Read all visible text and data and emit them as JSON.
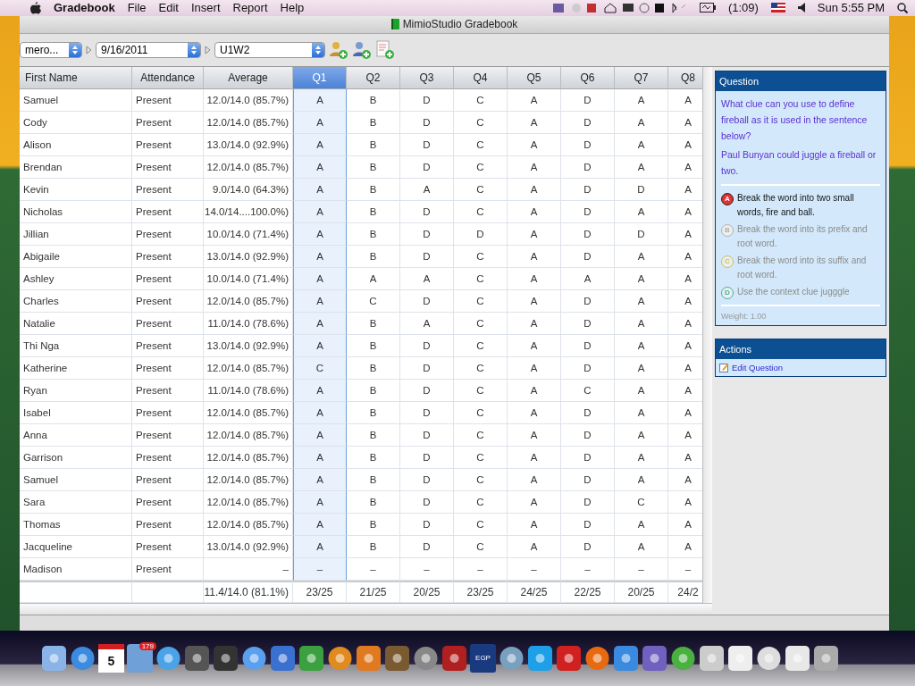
{
  "menu_bar": {
    "app_name": "Gradebook",
    "menus": [
      "File",
      "Edit",
      "Insert",
      "Report",
      "Help"
    ],
    "battery": "(1:09)",
    "clock": "Sun 5:55 PM"
  },
  "window": {
    "title": "MimioStudio Gradebook"
  },
  "toolbar": {
    "class_popup": "mero...",
    "date_popup": "9/16/2011",
    "assessment_popup": "U1W2"
  },
  "table": {
    "columns": [
      {
        "label": "First Name",
        "selected": false
      },
      {
        "label": "Attendance",
        "selected": false
      },
      {
        "label": "Average",
        "selected": false
      },
      {
        "label": "Q1",
        "selected": true
      },
      {
        "label": "Q2",
        "selected": false
      },
      {
        "label": "Q3",
        "selected": false
      },
      {
        "label": "Q4",
        "selected": false
      },
      {
        "label": "Q5",
        "selected": false
      },
      {
        "label": "Q6",
        "selected": false
      },
      {
        "label": "Q7",
        "selected": false
      },
      {
        "label": "Q8",
        "selected": false
      }
    ],
    "rows": [
      {
        "cells": [
          "Samuel",
          "Present",
          "12.0/14.0 (85.7%)",
          "A",
          "B",
          "D",
          "C",
          "A",
          "D",
          "A",
          "A"
        ]
      },
      {
        "cells": [
          "Cody",
          "Present",
          "12.0/14.0 (85.7%)",
          "A",
          "B",
          "D",
          "C",
          "A",
          "D",
          "A",
          "A"
        ]
      },
      {
        "cells": [
          "Alison",
          "Present",
          "13.0/14.0 (92.9%)",
          "A",
          "B",
          "D",
          "C",
          "A",
          "D",
          "A",
          "A"
        ]
      },
      {
        "cells": [
          "Brendan",
          "Present",
          "12.0/14.0 (85.7%)",
          "A",
          "B",
          "D",
          "C",
          "A",
          "D",
          "A",
          "A"
        ]
      },
      {
        "cells": [
          "Kevin",
          "Present",
          "9.0/14.0 (64.3%)",
          "A",
          "B",
          "A",
          "C",
          "A",
          "D",
          "D",
          "A"
        ]
      },
      {
        "cells": [
          "Nicholas",
          "Present",
          "14.0/14....100.0%)",
          "A",
          "B",
          "D",
          "C",
          "A",
          "D",
          "A",
          "A"
        ]
      },
      {
        "cells": [
          "Jillian",
          "Present",
          "10.0/14.0 (71.4%)",
          "A",
          "B",
          "D",
          "D",
          "A",
          "D",
          "D",
          "A"
        ]
      },
      {
        "cells": [
          "Abigaile",
          "Present",
          "13.0/14.0 (92.9%)",
          "A",
          "B",
          "D",
          "C",
          "A",
          "D",
          "A",
          "A"
        ]
      },
      {
        "cells": [
          "Ashley",
          "Present",
          "10.0/14.0 (71.4%)",
          "A",
          "A",
          "A",
          "C",
          "A",
          "A",
          "A",
          "A"
        ]
      },
      {
        "cells": [
          "Charles",
          "Present",
          "12.0/14.0 (85.7%)",
          "A",
          "C",
          "D",
          "C",
          "A",
          "D",
          "A",
          "A"
        ]
      },
      {
        "cells": [
          "Natalie",
          "Present",
          "11.0/14.0 (78.6%)",
          "A",
          "B",
          "A",
          "C",
          "A",
          "D",
          "A",
          "A"
        ]
      },
      {
        "cells": [
          "Thi Nga",
          "Present",
          "13.0/14.0 (92.9%)",
          "A",
          "B",
          "D",
          "C",
          "A",
          "D",
          "A",
          "A"
        ]
      },
      {
        "cells": [
          "Katherine",
          "Present",
          "12.0/14.0 (85.7%)",
          "C",
          "B",
          "D",
          "C",
          "A",
          "D",
          "A",
          "A"
        ]
      },
      {
        "cells": [
          "Ryan",
          "Present",
          "11.0/14.0 (78.6%)",
          "A",
          "B",
          "D",
          "C",
          "A",
          "C",
          "A",
          "A"
        ]
      },
      {
        "cells": [
          "Isabel",
          "Present",
          "12.0/14.0 (85.7%)",
          "A",
          "B",
          "D",
          "C",
          "A",
          "D",
          "A",
          "A"
        ]
      },
      {
        "cells": [
          "Anna",
          "Present",
          "12.0/14.0 (85.7%)",
          "A",
          "B",
          "D",
          "C",
          "A",
          "D",
          "A",
          "A"
        ]
      },
      {
        "cells": [
          "Garrison",
          "Present",
          "12.0/14.0 (85.7%)",
          "A",
          "B",
          "D",
          "C",
          "A",
          "D",
          "A",
          "A"
        ]
      },
      {
        "cells": [
          "Samuel",
          "Present",
          "12.0/14.0 (85.7%)",
          "A",
          "B",
          "D",
          "C",
          "A",
          "D",
          "A",
          "A"
        ]
      },
      {
        "cells": [
          "Sara",
          "Present",
          "12.0/14.0 (85.7%)",
          "A",
          "B",
          "D",
          "C",
          "A",
          "D",
          "C",
          "A"
        ]
      },
      {
        "cells": [
          "Thomas",
          "Present",
          "12.0/14.0 (85.7%)",
          "A",
          "B",
          "D",
          "C",
          "A",
          "D",
          "A",
          "A"
        ]
      },
      {
        "cells": [
          "Jacqueline",
          "Present",
          "13.0/14.0 (92.9%)",
          "A",
          "B",
          "D",
          "C",
          "A",
          "D",
          "A",
          "A"
        ]
      },
      {
        "cells": [
          "Madison",
          "Present",
          "–",
          "–",
          "–",
          "–",
          "–",
          "–",
          "–",
          "–",
          "–"
        ]
      }
    ],
    "totals": {
      "average": "11.4/14.0 (81.1%)",
      "questions": [
        "23/25",
        "21/25",
        "20/25",
        "23/25",
        "24/25",
        "22/25",
        "20/25",
        "24/2"
      ]
    }
  },
  "question_panel": {
    "title": "Question",
    "text": [
      "What clue can you use to define fireball as it is used in the sentence below?",
      "Paul Bunyan could juggle a fireball or two."
    ],
    "choices": [
      {
        "letter": "A",
        "text": "Break the word into two small words, fire and ball.",
        "selected": true
      },
      {
        "letter": "B",
        "text": "Break the word into its prefix and root word.",
        "selected": false
      },
      {
        "letter": "C",
        "text": "Break the word into its suffix and root word.",
        "selected": false
      },
      {
        "letter": "D",
        "text": "Use the context clue jugggle",
        "selected": false
      }
    ],
    "weight": "Weight: 1.00"
  },
  "actions_panel": {
    "title": "Actions",
    "items": [
      "Edit Question"
    ]
  },
  "dock": {
    "calendar_day": "5",
    "mail_badge": "179",
    "egp_label": "EGP"
  }
}
